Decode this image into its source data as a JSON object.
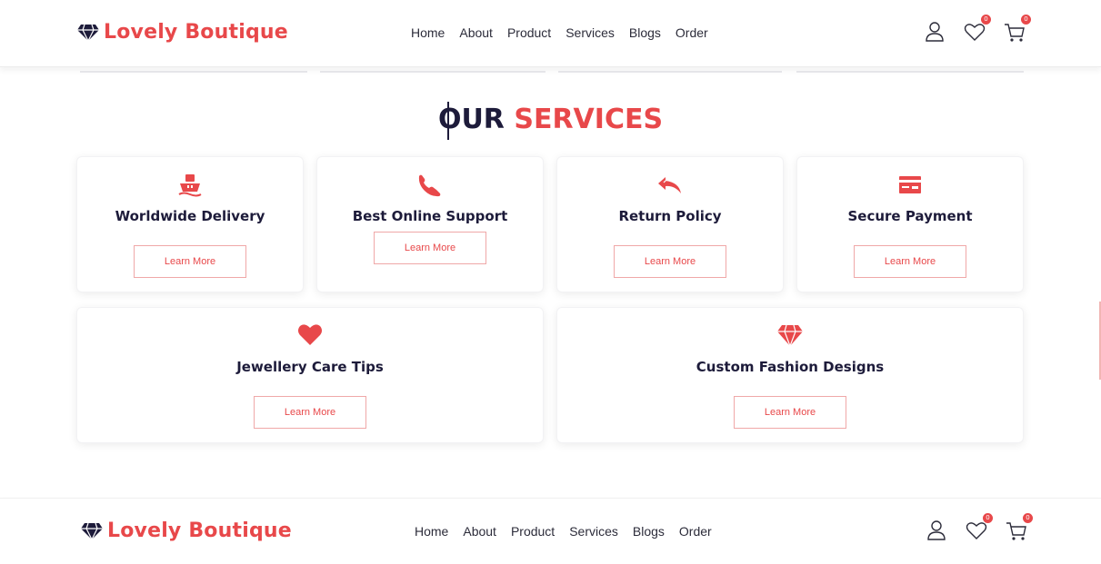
{
  "header": {
    "brand": "Lovely Boutique",
    "nav": [
      "Home",
      "About",
      "Product",
      "Services",
      "Blogs",
      "Order"
    ],
    "wishlist_count": "0",
    "cart_count": "0",
    "icons": [
      "user-icon",
      "heart-icon",
      "cart-icon"
    ]
  },
  "section": {
    "title_part1": "OUR",
    "title_part2": "SERVICES"
  },
  "services": [
    {
      "name": "Worldwide Delivery",
      "button": "Learn More",
      "icon": "ship-icon"
    },
    {
      "name": "Best Online Support",
      "button": "Learn More",
      "icon": "phone-icon"
    },
    {
      "name": "Return Policy",
      "button": "Learn More",
      "icon": "reply-icon"
    },
    {
      "name": "Secure Payment",
      "button": "Learn More",
      "icon": "credit-card-icon"
    },
    {
      "name": "Jewellery Care Tips",
      "button": "Learn More",
      "icon": "heart-icon"
    },
    {
      "name": "Custom Fashion Designs",
      "button": "Learn More",
      "icon": "gem-icon"
    }
  ],
  "colors": {
    "accent": "#e8484a",
    "dark": "#1d1b3a",
    "button_border": "#f0a8a8"
  }
}
